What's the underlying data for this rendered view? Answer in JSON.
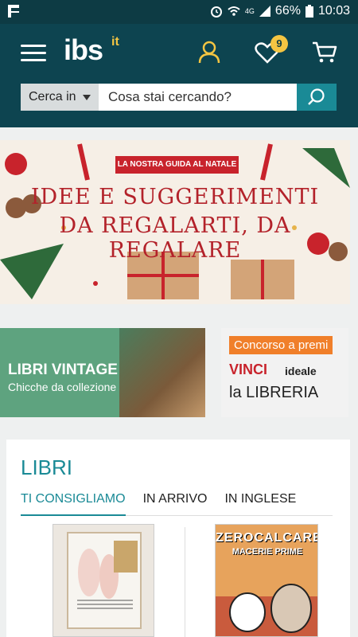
{
  "status_bar": {
    "network": "4G",
    "battery": "66%",
    "time": "10:03"
  },
  "header": {
    "logo": "ibs",
    "logo_suffix": "it",
    "wishlist_count": "9"
  },
  "search": {
    "category_label": "Cerca in",
    "placeholder": "Cosa stai cercando?"
  },
  "banners": {
    "xmas": {
      "ribbon": "LA NOSTRA GUIDA AL NATALE",
      "line1": "IDEE E SUGGERIMENTI",
      "line2": "DA REGALARTI, DA REGALARE"
    },
    "vintage": {
      "title": "LIBRI VINTAGE",
      "subtitle": "Chicche da collezione"
    },
    "concorso": {
      "tag": "Concorso a premi",
      "vinci": "VINCI",
      "ideale": "ideale",
      "libreria": "la LIBRERIA"
    }
  },
  "libri": {
    "title": "LIBRI",
    "tabs": [
      "TI CONSIGLIAMO",
      "IN ARRIVO",
      "IN INGLESE"
    ],
    "active_tab": "TI CONSIGLIAMO",
    "book2": {
      "author": "ZEROCALCARE",
      "title": "MACERIE PRIME"
    }
  },
  "colors": {
    "header_bg": "#0d4450",
    "accent": "#1a8a96",
    "badge": "#f4c542"
  }
}
